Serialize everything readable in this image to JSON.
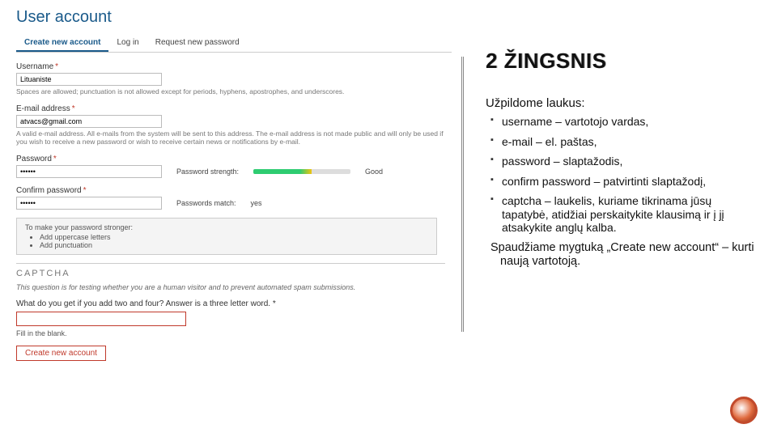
{
  "form": {
    "page_title": "User account",
    "tabs": {
      "create": "Create new account",
      "login": "Log in",
      "reset": "Request new password"
    },
    "username": {
      "label": "Username",
      "value": "Lituaniste",
      "help": "Spaces are allowed; punctuation is not allowed except for periods, hyphens, apostrophes, and underscores."
    },
    "email": {
      "label": "E-mail address",
      "value": "atvacs@gmail.com",
      "help": "A valid e-mail address. All e-mails from the system will be sent to this address. The e-mail address is not made public and will only be used if you wish to receive a new password or wish to receive certain news or notifications by e-mail."
    },
    "password": {
      "label": "Password",
      "value": "••••••",
      "strength_label": "Password strength:",
      "strength_value": "Good"
    },
    "confirm": {
      "label": "Confirm password",
      "value": "••••••",
      "match_label": "Passwords match:",
      "match_value": "yes"
    },
    "stronger": {
      "intro": "To make your password stronger:",
      "items": [
        "Add uppercase letters",
        "Add punctuation"
      ]
    },
    "captcha": {
      "heading": "CAPTCHA",
      "desc": "This question is for testing whether you are a human visitor and to prevent automated spam submissions.",
      "question": "What do you get if you add two and four? Answer is a three letter word.",
      "fill": "Fill in the blank."
    },
    "submit_label": "Create new account",
    "required_marker": "*"
  },
  "slide": {
    "title": "2 ŽINGSNIS",
    "intro": "Užpildome laukus:",
    "bullets": [
      "username – vartotojo vardas,",
      "e-mail – el. paštas,",
      "password – slaptažodis,",
      "confirm password – patvirtinti slaptažodį,",
      "captcha – laukelis, kuriame tikrinama jūsų tapatybė, atidžiai perskaitykite klausimą ir į jį atsakykite anglų kalba."
    ],
    "outro": "Spaudžiame mygtuką „Create new account“ – kurti naują vartotoją."
  }
}
